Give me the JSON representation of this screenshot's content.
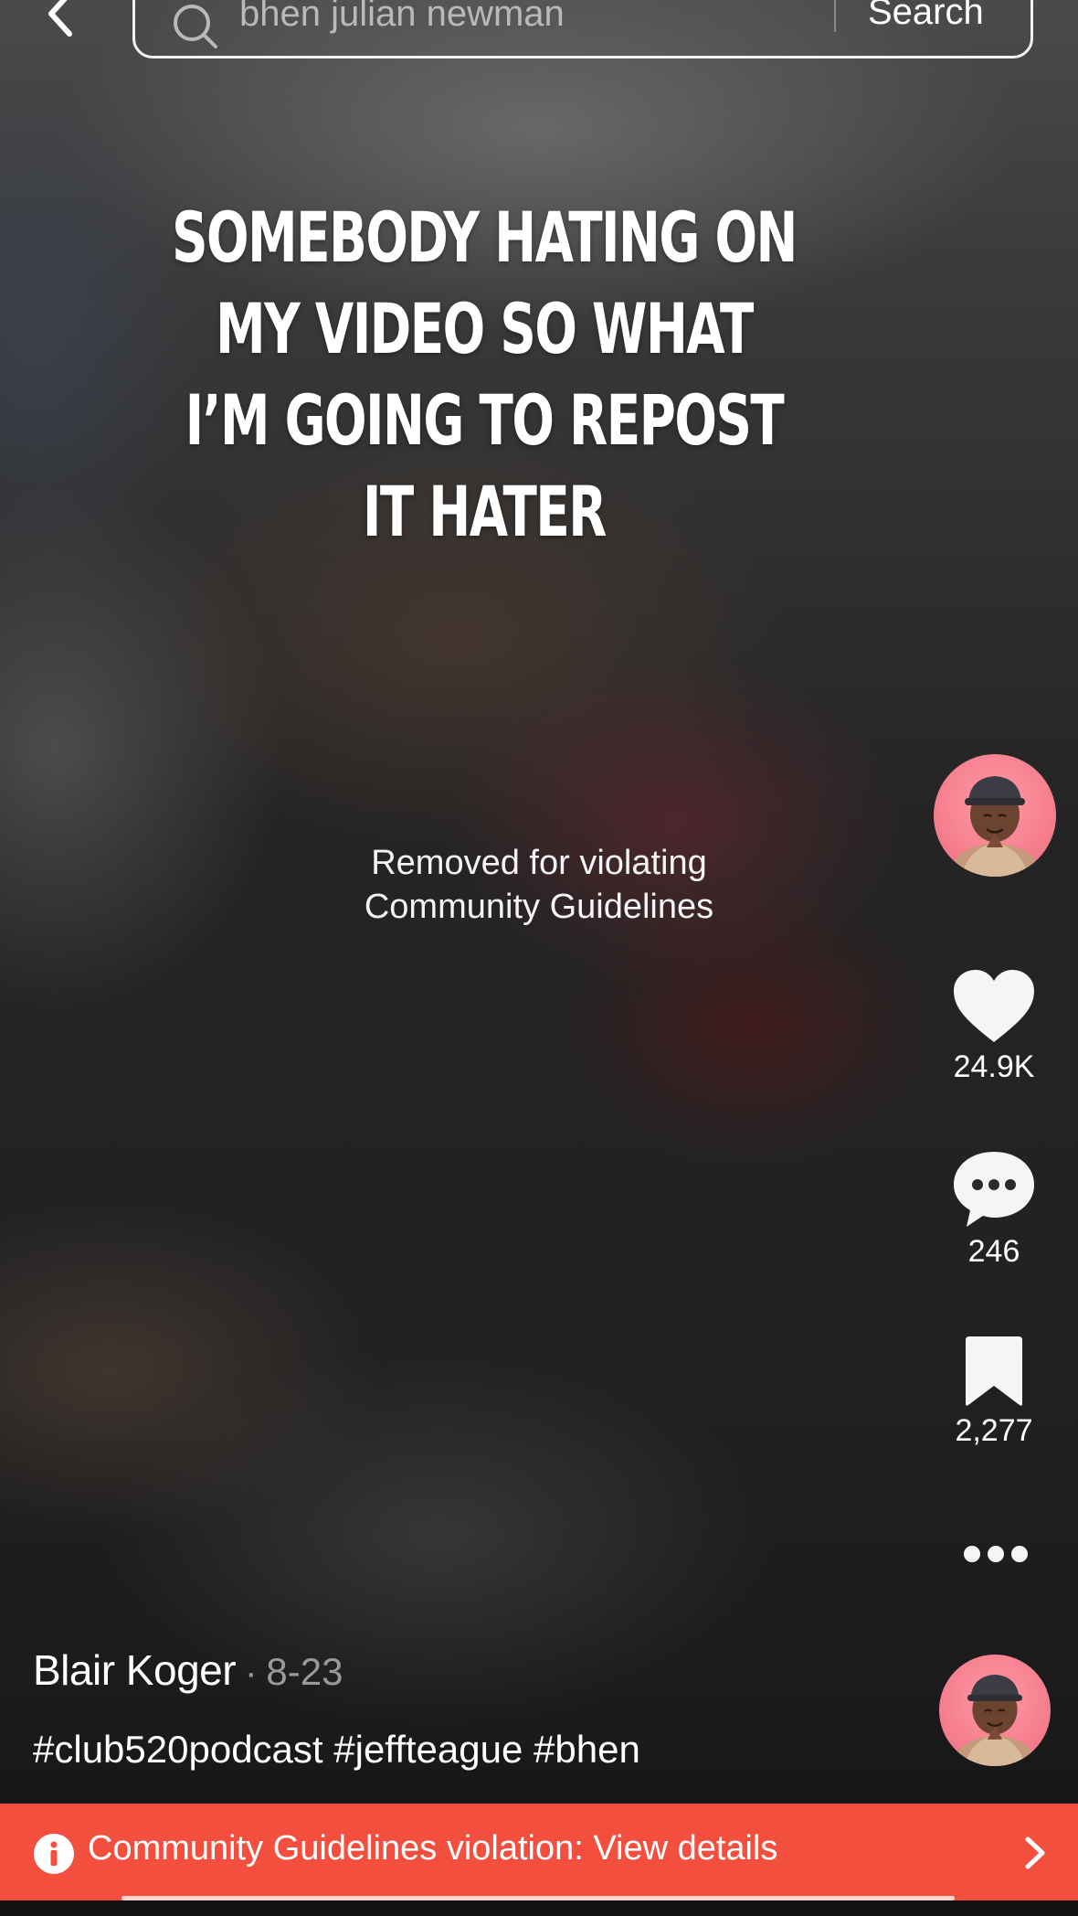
{
  "search": {
    "query": "bhen julian newman",
    "button_label": "Search"
  },
  "video": {
    "caption_overlay": "Somebody hating on my video so what I’m going to repost it hater",
    "removed_notice_line1": "Removed for violating",
    "removed_notice_line2": "Community Guidelines"
  },
  "actions": {
    "likes": "24.9K",
    "comments": "246",
    "saves": "2,277"
  },
  "post": {
    "author": "Blair Koger",
    "separator": "·",
    "date": "8-23",
    "hashtags": "#club520podcast #jeffteague #bhen"
  },
  "banner": {
    "text": "Community Guidelines violation: View details",
    "color": "#f24f3f"
  },
  "icons": [
    "back-icon",
    "search-icon",
    "heart-icon",
    "comment-icon",
    "bookmark-icon",
    "more-icon",
    "info-icon",
    "chevron-right-icon"
  ]
}
